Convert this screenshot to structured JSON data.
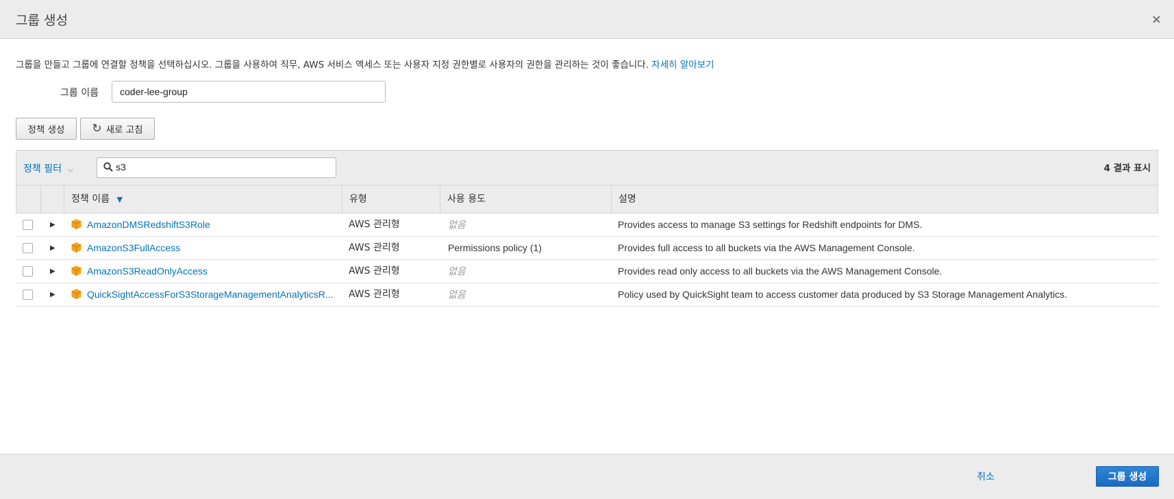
{
  "modal": {
    "title": "그룹 생성",
    "close_symbol": "×"
  },
  "description": {
    "text": "그룹을 만들고 그룹에 연결할 정책을 선택하십시오. 그룹을 사용하여 직무, AWS 서비스 액세스 또는 사용자 지정 권한별로 사용자의 권한을 관리하는 것이 좋습니다.",
    "link": "자세히 알아보기"
  },
  "group": {
    "label": "그룹 이름",
    "value": "coder-lee-group"
  },
  "toolbar": {
    "create_policy": "정책 생성",
    "refresh": "새로 고침"
  },
  "filter": {
    "label": "정책 필터",
    "search_value": "s3",
    "result_count": "4 결과 표시"
  },
  "table": {
    "headers": {
      "name": "정책 이름",
      "type": "유형",
      "usage": "사용 용도",
      "description": "설명"
    },
    "rows": [
      {
        "name": "AmazonDMSRedshiftS3Role",
        "type": "AWS 관리형",
        "usage": "없음",
        "description": "Provides access to manage S3 settings for Redshift endpoints for DMS."
      },
      {
        "name": "AmazonS3FullAccess",
        "type": "AWS 관리형",
        "usage": "Permissions policy (1)",
        "description": "Provides full access to all buckets via the AWS Management Console."
      },
      {
        "name": "AmazonS3ReadOnlyAccess",
        "type": "AWS 관리형",
        "usage": "없음",
        "description": "Provides read only access to all buckets via the AWS Management Console."
      },
      {
        "name": "QuickSightAccessForS3StorageManagementAnalyticsR...",
        "type": "AWS 관리형",
        "usage": "없음",
        "description": "Policy used by QuickSight team to access customer data produced by S3 Storage Management Analytics."
      }
    ]
  },
  "footer": {
    "cancel": "취소",
    "create_group": "그룹 생성"
  },
  "colors": {
    "link": "#0073bb",
    "primary_button": "#1a6bbf",
    "header_bg": "#ececec",
    "policy_icon": "#f7a21b"
  },
  "icons": {
    "policy": "aws-box-icon",
    "search": "search-icon",
    "refresh": "refresh-icon",
    "expand": "caret-right-icon",
    "sort": "sort-down-icon"
  }
}
